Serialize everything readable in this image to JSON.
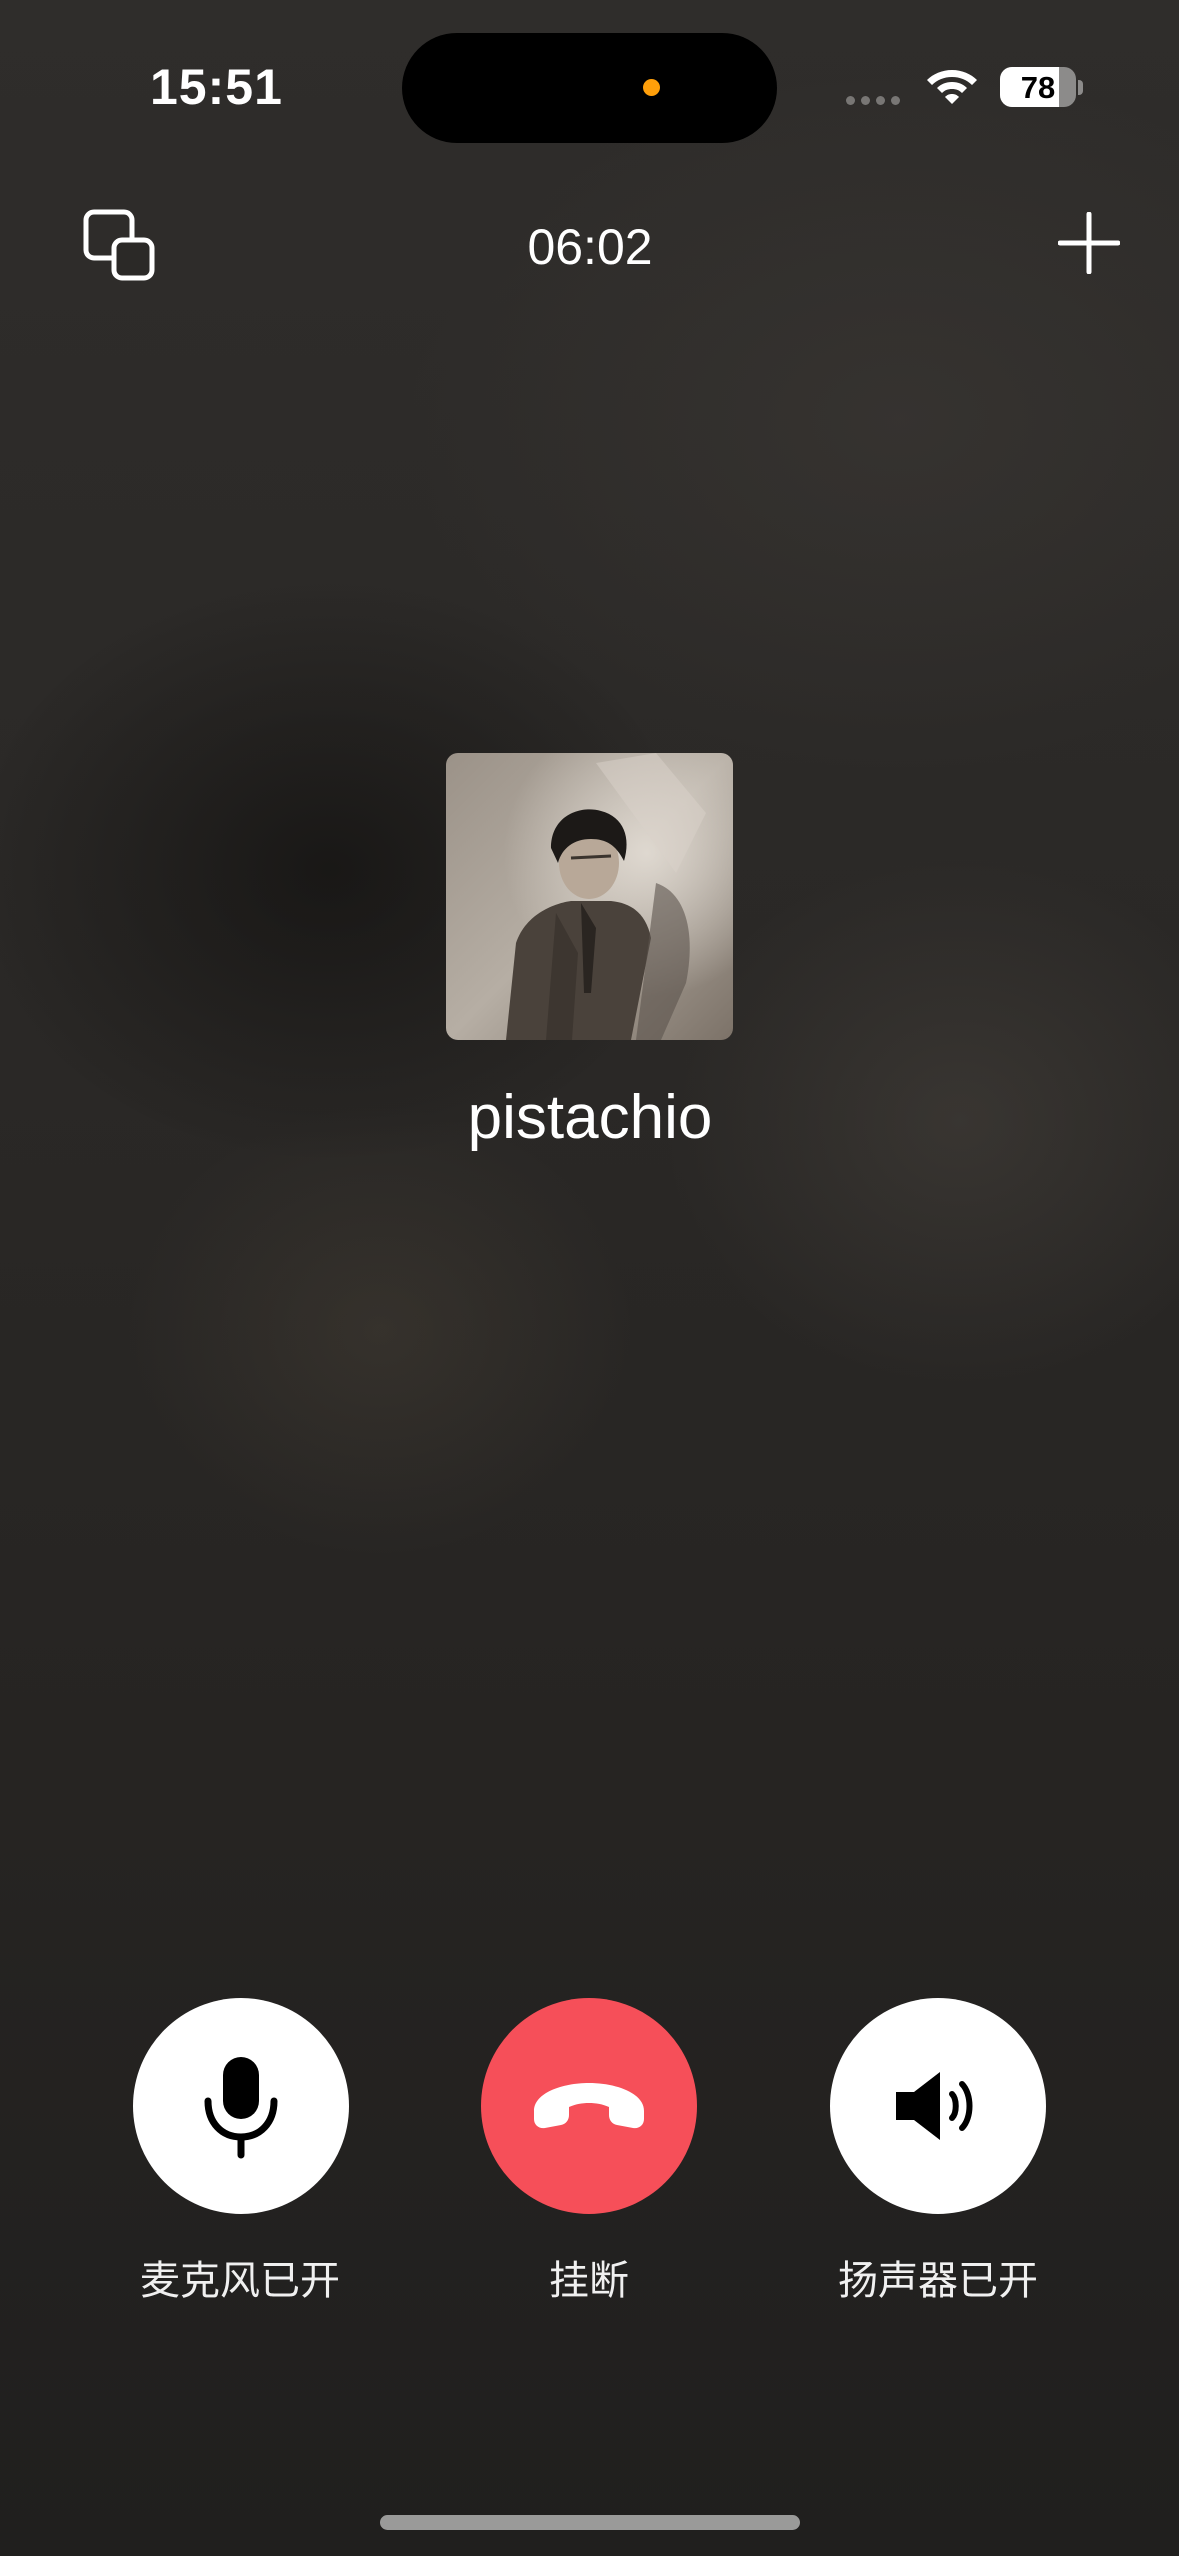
{
  "status_bar": {
    "time": "15:51",
    "battery_level": "78",
    "battery_fraction": 0.78,
    "icons": [
      "cellular-signal-icon",
      "wifi-icon",
      "battery-icon"
    ],
    "recording_indicator_color": "#ff9f0a"
  },
  "call": {
    "duration": "06:02",
    "caller_name": "pistachio",
    "top_left_icon": "minimize-window-icon",
    "top_right_icon": "add-participant-icon"
  },
  "controls": {
    "microphone": {
      "label": "麦克风已开",
      "icon": "microphone-icon",
      "color": "#ffffff"
    },
    "hangup": {
      "label": "挂断",
      "icon": "phone-hangup-icon",
      "color": "#f64f59"
    },
    "speaker": {
      "label": "扬声器已开",
      "icon": "speaker-icon",
      "color": "#ffffff"
    }
  }
}
